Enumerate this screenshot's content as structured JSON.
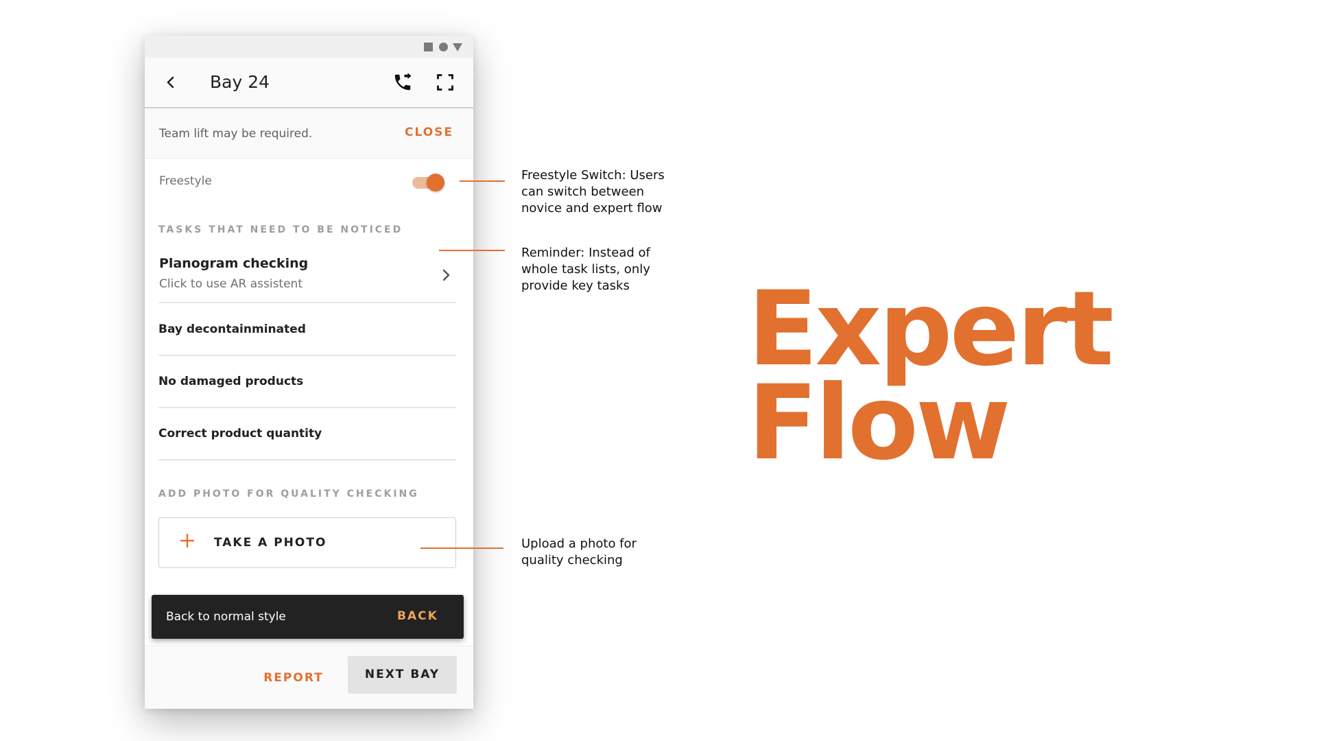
{
  "status_bar": {
    "icons": [
      "square-icon",
      "circle-icon",
      "triangle-icon"
    ]
  },
  "app_bar": {
    "title": "Bay 24",
    "icons": [
      "chevron-left-icon",
      "phone-forward-icon",
      "fullscreen-icon"
    ]
  },
  "banner": {
    "text": "Team lift may be required.",
    "action": "CLOSE"
  },
  "freestyle": {
    "label": "Freestyle",
    "on": true
  },
  "tasks": {
    "header": "TASKS THAT NEED TO BE NOTICED",
    "primary": {
      "title": "Planogram checking",
      "subtitle": "Click to use AR assistent"
    },
    "items": [
      {
        "label": "Bay decontainminated"
      },
      {
        "label": "No damaged products"
      },
      {
        "label": "Correct product quantity"
      }
    ]
  },
  "photo": {
    "header": "ADD PHOTO FOR QUALITY CHECKING",
    "button": "TAKE A PHOTO"
  },
  "snackbar": {
    "text": "Back to normal style",
    "action": "BACK"
  },
  "footer": {
    "report": "REPORT",
    "next": "NEXT BAY"
  },
  "annotations": [
    {
      "lines": [
        "Freestyle Switch: Users",
        "can switch between",
        "novice and expert flow"
      ]
    },
    {
      "lines": [
        "Reminder: Instead of",
        "whole task lists, only",
        "provide key tasks"
      ]
    },
    {
      "lines": [
        "Upload a photo for",
        "quality checking"
      ]
    }
  ],
  "headline": {
    "line1": "Expert",
    "line2": "Flow"
  },
  "colors": {
    "accent": "#e2702f",
    "snackbar_bg": "#222222",
    "snackbar_action": "#f0a45a",
    "toggle_track": "#eebb9a"
  }
}
